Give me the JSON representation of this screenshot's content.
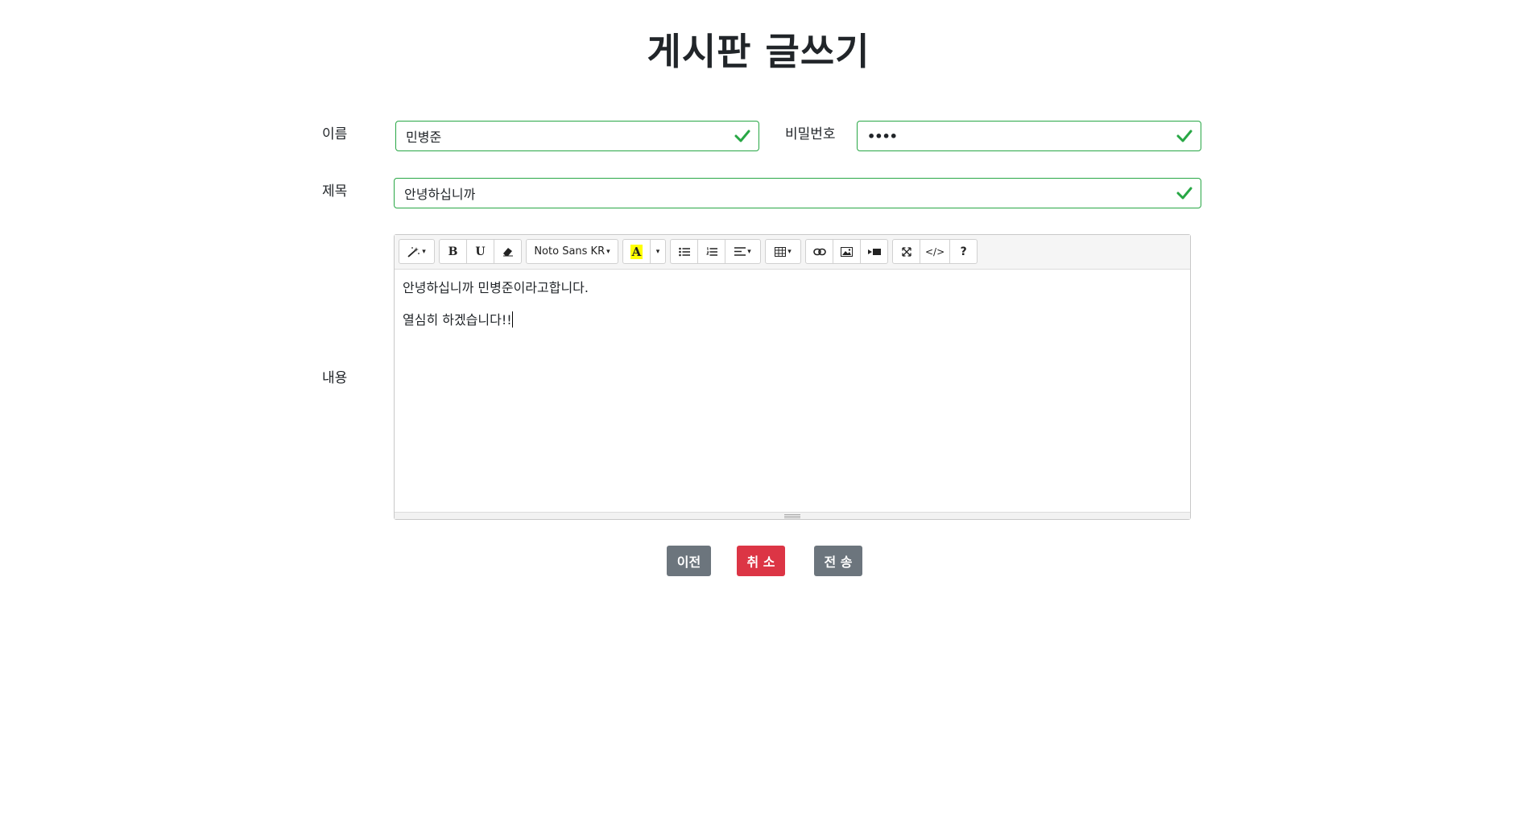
{
  "page": {
    "title": "게시판 글쓰기"
  },
  "form": {
    "name_label": "이름",
    "name_value": "민병준",
    "password_label": "비밀번호",
    "password_value": "••••",
    "subject_label": "제목",
    "subject_value": "안녕하십니까",
    "content_label": "내용"
  },
  "editor": {
    "toolbar": {
      "style_icon": "magic-wand-icon",
      "bold_label": "B",
      "underline_label": "U",
      "clear_format_icon": "eraser-icon",
      "font_name": "Noto Sans KR",
      "color_label": "A",
      "color_highlight": "#ffff00",
      "unordered_list_icon": "bulleted-list-icon",
      "ordered_list_icon": "numbered-list-icon",
      "paragraph_icon": "align-left-icon",
      "table_icon": "table-icon",
      "link_icon": "link-icon",
      "picture_icon": "picture-icon",
      "video_icon": "video-icon",
      "fullscreen_icon": "fullscreen-icon",
      "codeview_label": "</>",
      "help_label": "?"
    },
    "content_lines": [
      "안녕하십니까 민병준이라고합니다.",
      "열심히 하겠습니다!!"
    ]
  },
  "actions": {
    "prev_label": "이전",
    "cancel_label": "취 소",
    "submit_label": "전 송"
  },
  "colors": {
    "valid": "#28a745",
    "secondary": "#6c757d",
    "danger": "#dc3545"
  }
}
